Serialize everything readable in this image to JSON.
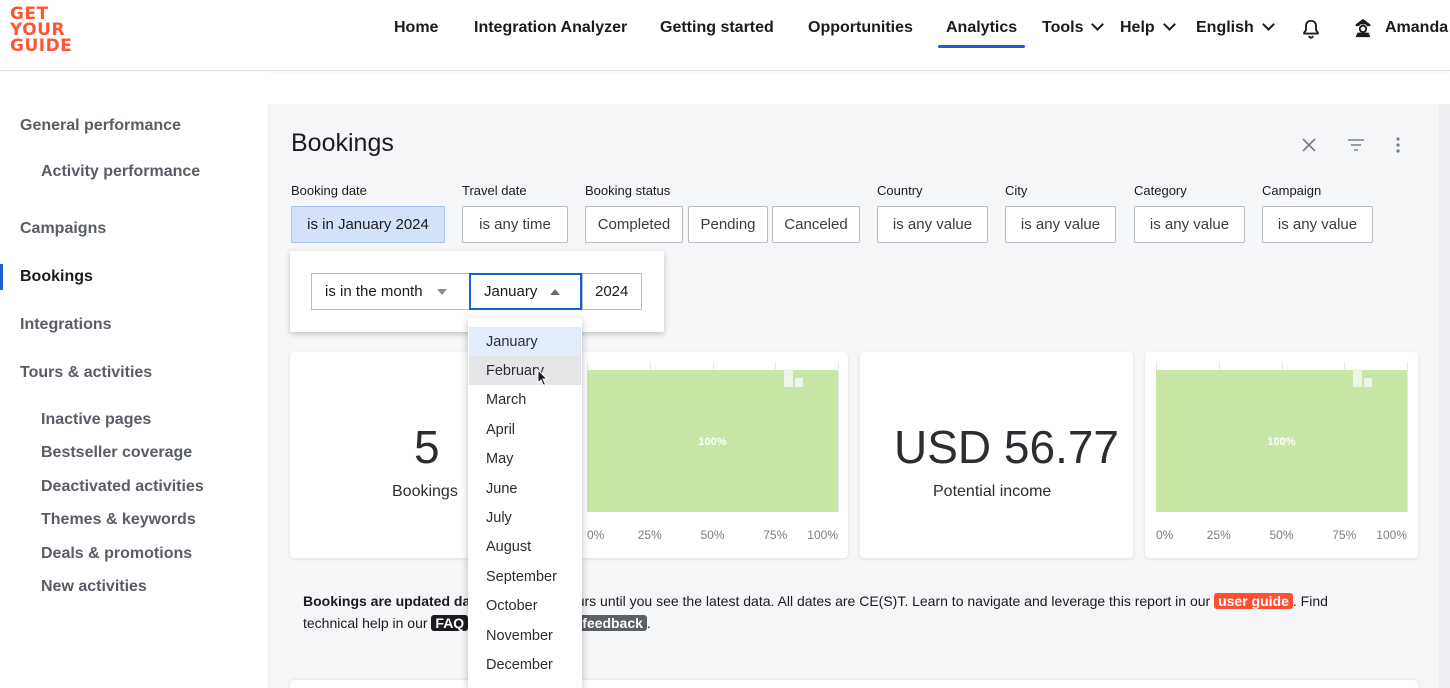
{
  "brand": {
    "logo_lines": [
      "GET",
      "YOUR",
      "GUIDE"
    ],
    "accent": "#ff5533"
  },
  "nav": {
    "items": [
      "Home",
      "Integration Analyzer",
      "Getting started",
      "Opportunities",
      "Analytics"
    ],
    "tools": "Tools",
    "help": "Help",
    "language": "English",
    "user": "Amanda",
    "active": "Analytics"
  },
  "sidebar": {
    "general_performance": "General performance",
    "activity_performance": "Activity performance",
    "campaigns": "Campaigns",
    "bookings": "Bookings",
    "integrations": "Integrations",
    "tours_activities": "Tours & activities",
    "sub_items": [
      "Inactive pages",
      "Bestseller coverage",
      "Deactivated activities",
      "Themes & keywords",
      "Deals & promotions",
      "New activities"
    ]
  },
  "page": {
    "title": "Bookings"
  },
  "filters": {
    "booking_date": {
      "label": "Booking date",
      "value": "is in January 2024"
    },
    "travel_date": {
      "label": "Travel date",
      "value": "is any time"
    },
    "booking_status": {
      "label": "Booking status",
      "options": [
        "Completed",
        "Pending",
        "Canceled"
      ]
    },
    "country": {
      "label": "Country",
      "value": "is any value"
    },
    "city": {
      "label": "City",
      "value": "is any value"
    },
    "category": {
      "label": "Category",
      "value": "is any value"
    },
    "campaign": {
      "label": "Campaign",
      "value": "is any value"
    }
  },
  "date_popover": {
    "condition": "is in the month",
    "month": "January",
    "year": "2024"
  },
  "months": [
    "January",
    "February",
    "March",
    "April",
    "May",
    "June",
    "July",
    "August",
    "September",
    "October",
    "November",
    "December"
  ],
  "month_selected": "January",
  "month_hovered": "February",
  "cards": {
    "bookings": {
      "value": "5",
      "label": "Bookings"
    },
    "income": {
      "value": "USD 56.77",
      "label": "Potential income"
    }
  },
  "chart_data": [
    {
      "type": "bar",
      "orientation": "horizontal",
      "categories": [
        ""
      ],
      "values": [
        100
      ],
      "data_labels": [
        "100%"
      ],
      "xticks": [
        "0%",
        "25%",
        "50%",
        "75%",
        "100%"
      ],
      "xlim": [
        0,
        100
      ],
      "color": "#c8e6a5"
    },
    {
      "type": "bar",
      "orientation": "horizontal",
      "categories": [
        ""
      ],
      "values": [
        100
      ],
      "data_labels": [
        "100%"
      ],
      "xticks": [
        "0%",
        "25%",
        "50%",
        "75%",
        "100%"
      ],
      "xlim": [
        0,
        100
      ],
      "color": "#c8e6a5"
    }
  ],
  "info": {
    "bold_part": "Bookings are updated dai",
    "text1": "hours until you see the latest data. All dates are CE(S)T. Learn to navigate and leverage this report in our",
    "user_guide": "user guide",
    "text2": ". Find",
    "text3": "technical help in our",
    "faq": "FAQ",
    "feedback": "feedback",
    "text4": "."
  }
}
